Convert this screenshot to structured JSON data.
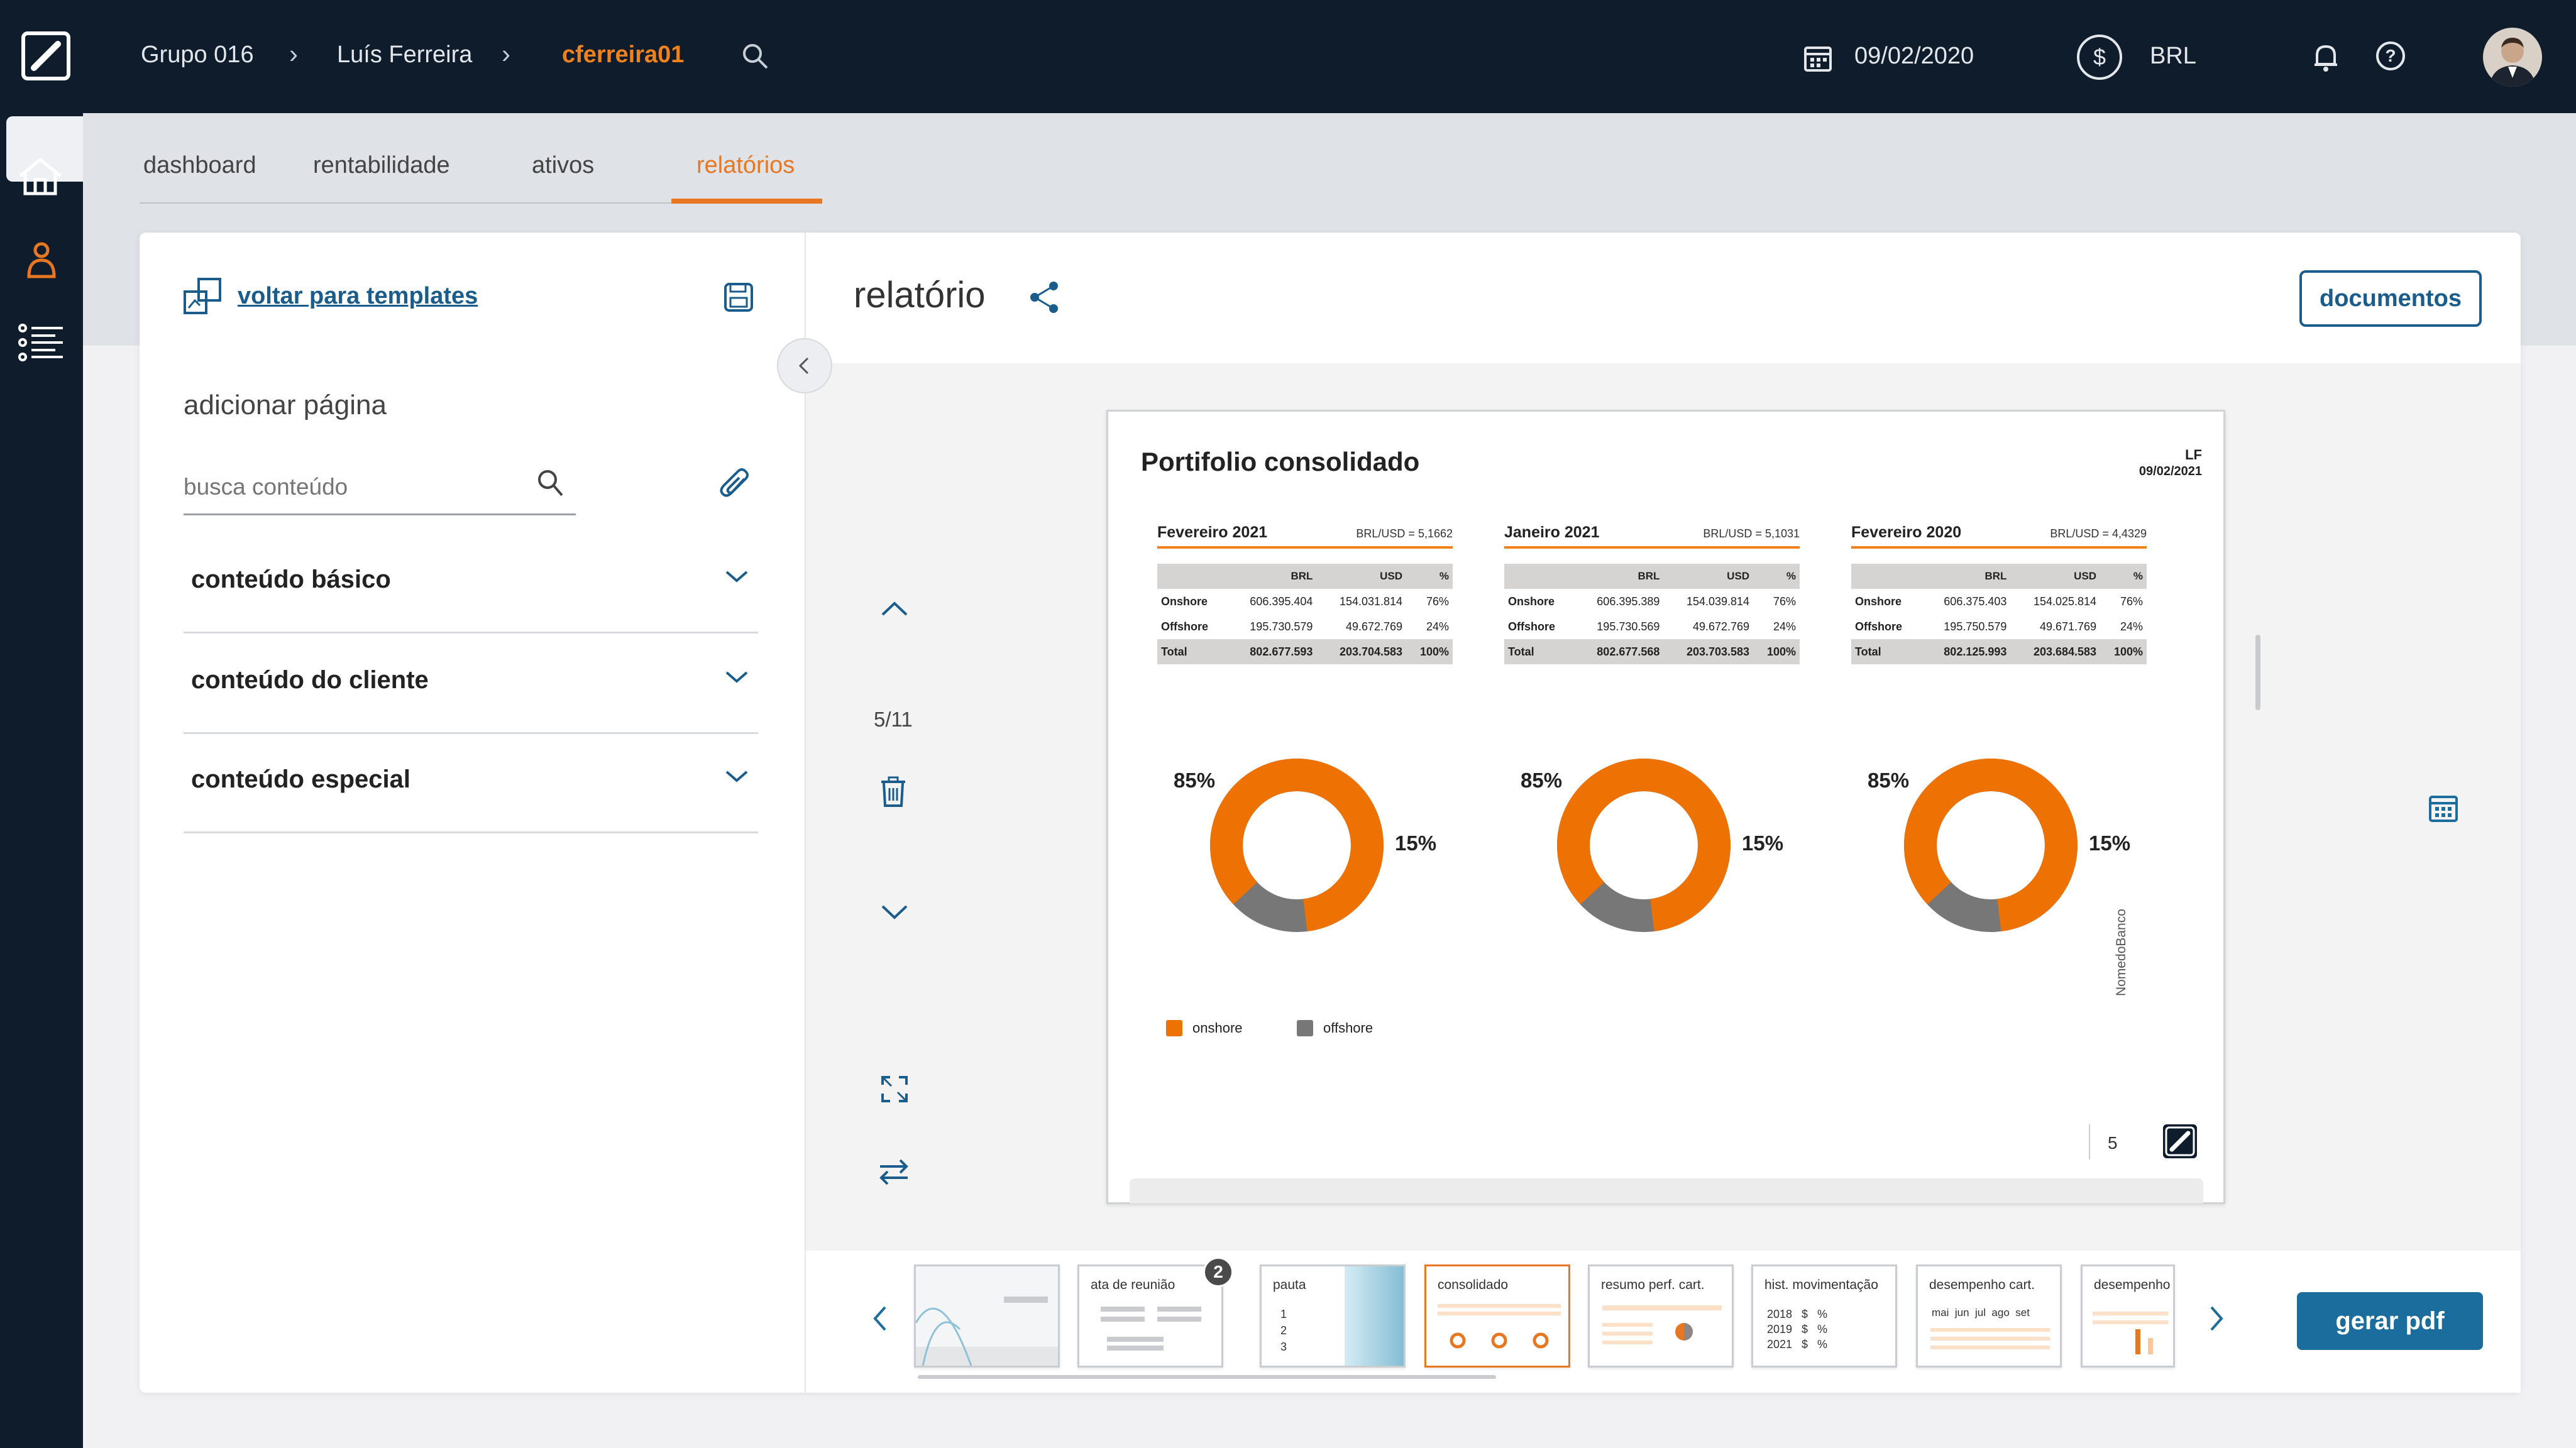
{
  "header": {
    "breadcrumb": [
      "Grupo 016",
      "Luís Ferreira",
      "cferreira01"
    ],
    "date": "09/02/2020",
    "currency": "BRL",
    "currency_symbol": "$",
    "icons": [
      "logo-icon",
      "search-icon",
      "calendar-icon",
      "currency-icon",
      "bell-icon",
      "help-icon",
      "avatar"
    ]
  },
  "sidebar": {
    "items": [
      "home-icon",
      "client-icon",
      "list-icon"
    ]
  },
  "tabs": [
    "dashboard",
    "rentabilidade",
    "ativos",
    "relatórios"
  ],
  "left_panel": {
    "back_link": "voltar para templates",
    "add_page_title": "adicionar página",
    "search_placeholder": "busca conteúdo",
    "sections": [
      "conteúdo básico",
      "conteúdo do cliente",
      "conteúdo especial"
    ]
  },
  "report": {
    "title": "relatório",
    "documents_button": "documentos",
    "page_indicator": "5/11",
    "generate_button": "gerar pdf"
  },
  "doc": {
    "title": "Portifolio consolidado",
    "initials": "LF",
    "date": "09/02/2021",
    "brand_vertical": "NomedoBanco",
    "page_number": "5",
    "col_headers": [
      "",
      "BRL",
      "USD",
      "%"
    ],
    "legend": [
      "onshore",
      "offshore"
    ],
    "tables": [
      {
        "title": "Fevereiro 2021",
        "rate": "BRL/USD = 5,1662",
        "rows": [
          [
            "Onshore",
            "606.395.404",
            "154.031.814",
            "76%"
          ],
          [
            "Offshore",
            "195.730.579",
            "49.672.769",
            "24%"
          ],
          [
            "Total",
            "802.677.593",
            "203.704.583",
            "100%"
          ]
        ],
        "donut": {
          "major": "85%",
          "minor": "15%",
          "onshore_share": 0.85
        }
      },
      {
        "title": "Janeiro 2021",
        "rate": "BRL/USD = 5,1031",
        "rows": [
          [
            "Onshore",
            "606.395.389",
            "154.039.814",
            "76%"
          ],
          [
            "Offshore",
            "195.730.569",
            "49.672.769",
            "24%"
          ],
          [
            "Total",
            "802.677.568",
            "203.703.583",
            "100%"
          ]
        ],
        "donut": {
          "major": "85%",
          "minor": "15%",
          "onshore_share": 0.85
        }
      },
      {
        "title": "Fevereiro 2020",
        "rate": "BRL/USD = 4,4329",
        "rows": [
          [
            "Onshore",
            "606.375.403",
            "154.025.814",
            "76%"
          ],
          [
            "Offshore",
            "195.750.579",
            "49.671.769",
            "24%"
          ],
          [
            "Total",
            "802.125.993",
            "203.684.583",
            "100%"
          ]
        ],
        "donut": {
          "major": "85%",
          "minor": "15%",
          "onshore_share": 0.85
        }
      }
    ]
  },
  "thumbnails": {
    "items": [
      {
        "label": ""
      },
      {
        "label": "ata de reunião",
        "badge": "2"
      },
      {
        "label": "pauta",
        "lines": [
          "1",
          "2",
          "3"
        ]
      },
      {
        "label": "consolidado"
      },
      {
        "label": "resumo perf. cart."
      },
      {
        "label": "hist. movimentação",
        "lines": [
          "2018   $   %",
          "2019   $   %",
          "2021   $   %"
        ]
      },
      {
        "label": "desempenho cart.",
        "lines": [
          "mai  jun  jul  ago  set"
        ]
      },
      {
        "label": "desempenho"
      }
    ]
  },
  "colors": {
    "navy": "#0e1c2b",
    "accent": "#e87722",
    "blue": "#1a5d8c",
    "gray": "#777777"
  }
}
